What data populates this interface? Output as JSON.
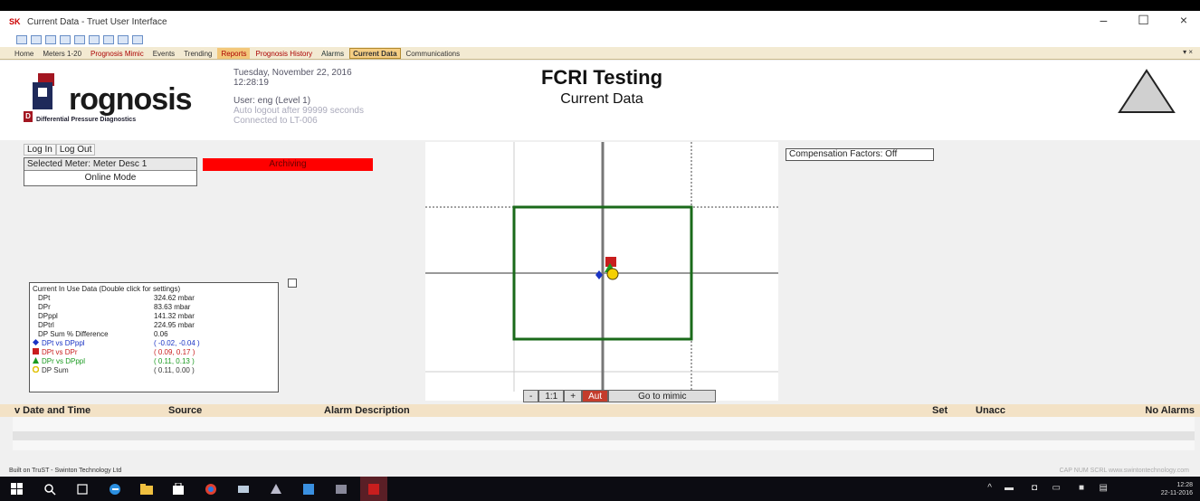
{
  "window": {
    "title": "Current Data - Truet User Interface",
    "app_badge": "SK"
  },
  "tabs": [
    {
      "label": "Home",
      "cls": ""
    },
    {
      "label": "Meters 1-20",
      "cls": ""
    },
    {
      "label": "Prognosis Mimic",
      "cls": "prog"
    },
    {
      "label": "Events",
      "cls": ""
    },
    {
      "label": "Trending",
      "cls": ""
    },
    {
      "label": "Reports",
      "cls": "reports"
    },
    {
      "label": "Prognosis History",
      "cls": "prog"
    },
    {
      "label": "Alarms",
      "cls": "alarms"
    },
    {
      "label": "Current Data",
      "cls": "active"
    },
    {
      "label": "Communications",
      "cls": ""
    }
  ],
  "header": {
    "logo_word": "rognosis",
    "logo_sub": "Differential Pressure Diagnostics",
    "date": "Tuesday, November 22, 2016",
    "time": "12:28:19",
    "user": "User: eng (Level 1)",
    "auto_logout": "Auto logout after 99999 seconds",
    "connected": "Connected to LT-006",
    "title": "FCRI Testing",
    "subtitle": "Current Data"
  },
  "controls": {
    "login": "Log In",
    "logout": "Log Out",
    "selected_meter": "Selected Meter: Meter Desc 1",
    "mode": "Online Mode",
    "archiving": "Archiving",
    "compensation": "Compensation Factors: Off"
  },
  "inuse": {
    "title": "Current In Use Data (Double click for settings)",
    "rows": [
      {
        "label": "DPt",
        "value": "324.62 mbar"
      },
      {
        "label": "DPr",
        "value": "83.63 mbar"
      },
      {
        "label": "DPppl",
        "value": "141.32 mbar"
      },
      {
        "label": "DPtrl",
        "value": "224.95 mbar"
      },
      {
        "label": "DP Sum % Difference",
        "value": "0.06"
      }
    ],
    "legend": [
      {
        "label": "DPt vs DPppl",
        "value": "( -0.02, -0.04 )",
        "color": "#1a33c4",
        "marker": "diamond"
      },
      {
        "label": "DPt vs DPr",
        "value": "( 0.09, 0.17 )",
        "color": "#c81e1e",
        "marker": "square"
      },
      {
        "label": "DPr vs DPppl",
        "value": "( 0.11, 0.13 )",
        "color": "#1a9a20",
        "marker": "triangle"
      },
      {
        "label": "DP Sum",
        "value": "( 0.11, 0.00 )",
        "color": "#e0c000",
        "marker": "circle"
      }
    ]
  },
  "plot_toolbar": {
    "minus": "-",
    "ratio": "1:1",
    "plus": "+",
    "auto": "Aut",
    "goto": "Go to mimic"
  },
  "alarms": {
    "col_time": "v Date and Time",
    "col_source": "Source",
    "col_desc": "Alarm Description",
    "col_set": "Set",
    "col_unack": "Unacc",
    "col_none": "No Alarms"
  },
  "statusbar": {
    "left": "Built on TruST - Swinton Technology Ltd",
    "right": "CAP NUM SCRL  www.swintontechnology.com"
  },
  "taskbar": {
    "time": "12:28",
    "date": "22-11-2016"
  }
}
